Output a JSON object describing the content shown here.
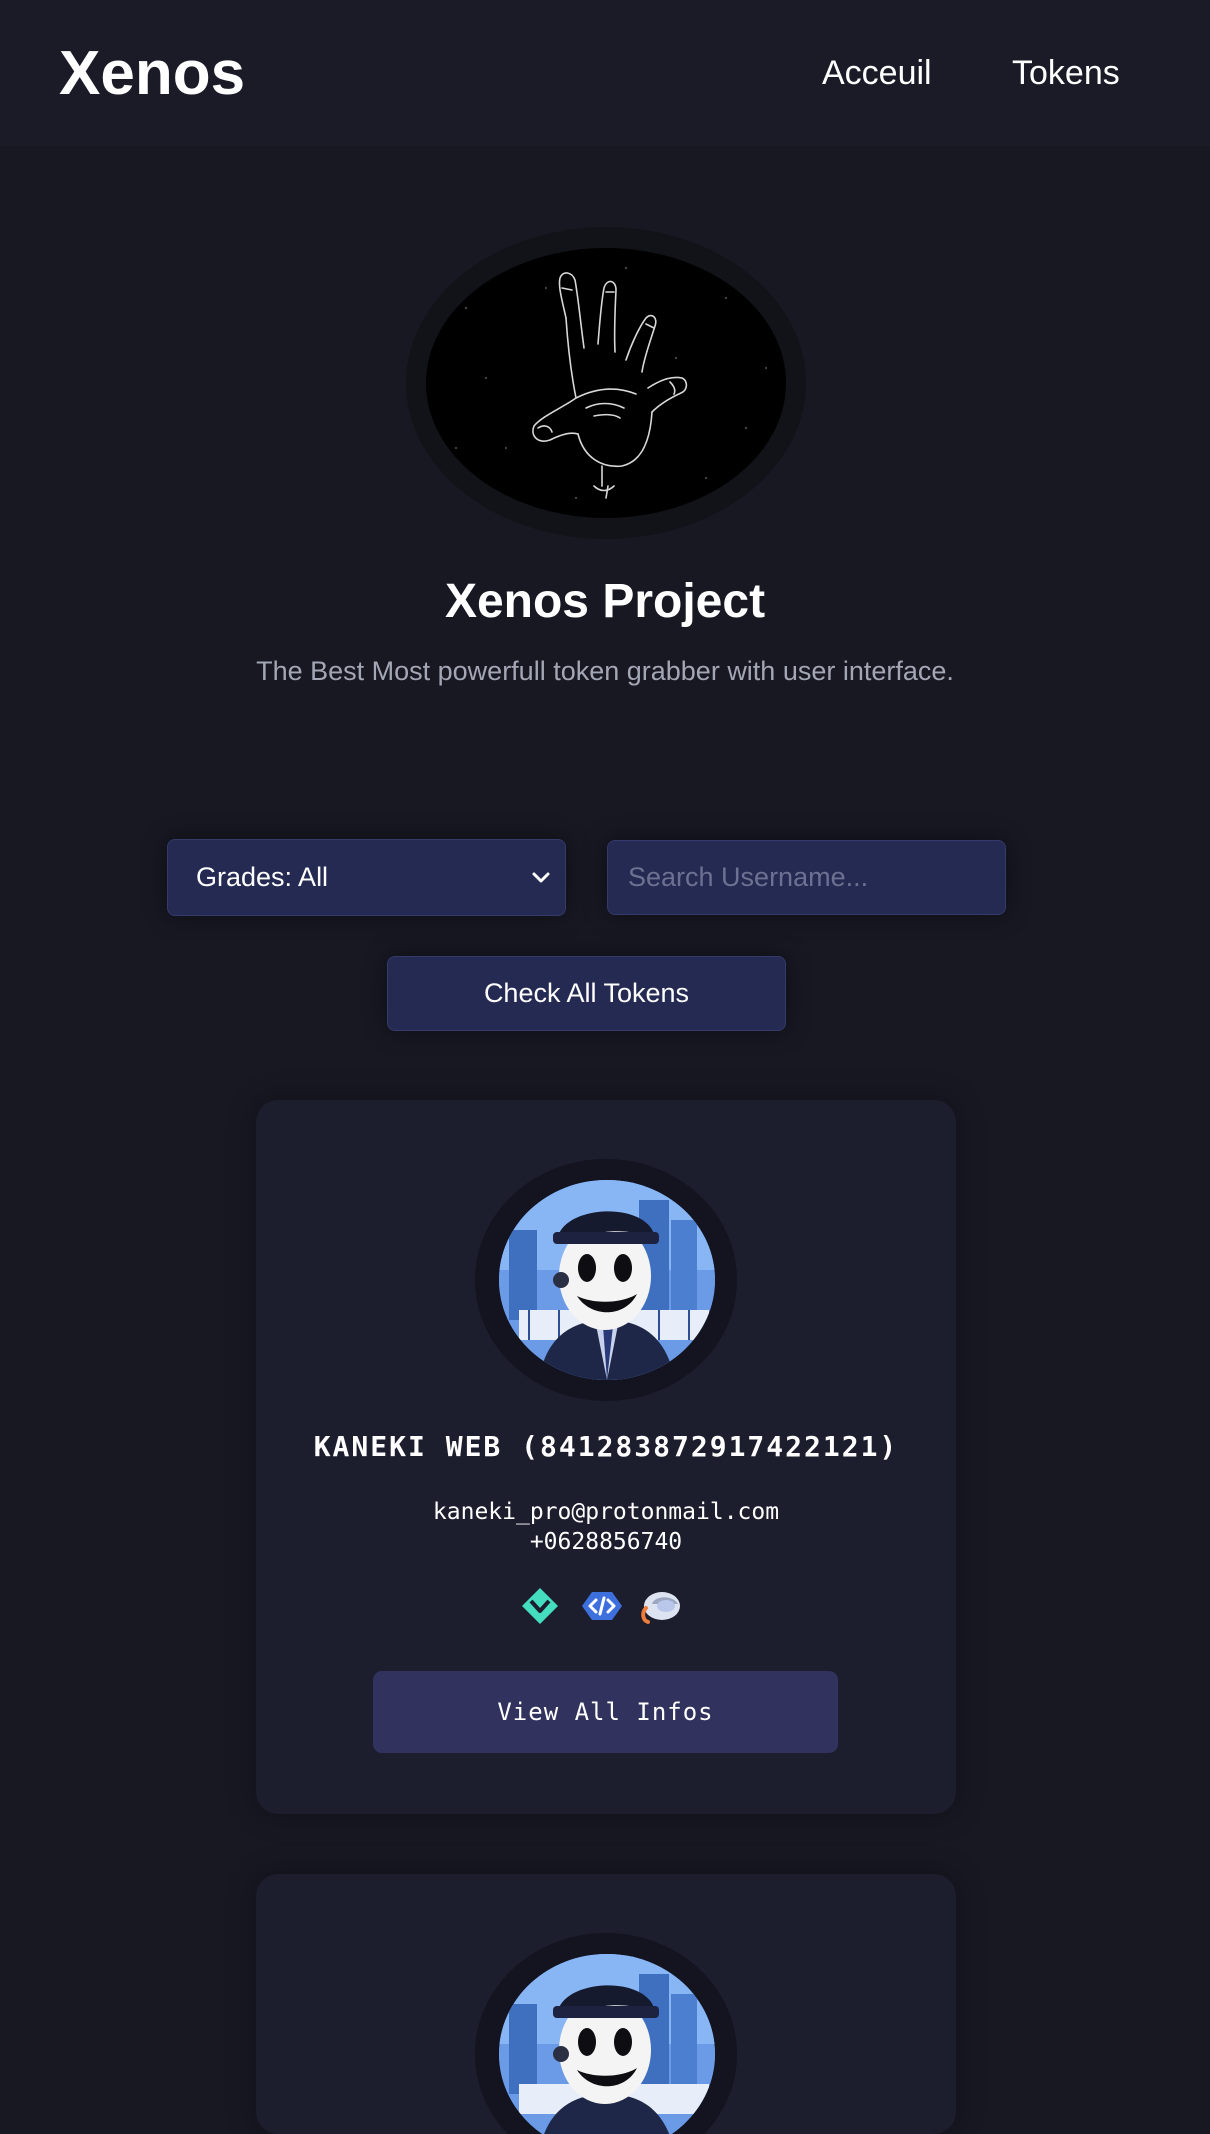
{
  "navbar": {
    "brand": "Xenos",
    "links": [
      "Acceuil",
      "Tokens"
    ]
  },
  "hero": {
    "logo_icon": "hand-sketch-icon",
    "title": "Xenos Project",
    "subtitle": "The Best Most powerfull token grabber with user interface."
  },
  "filters": {
    "grade_select": {
      "value": "Grades: All",
      "options": [
        "Grades: All"
      ]
    },
    "search": {
      "value": "",
      "placeholder": "Search Username..."
    },
    "check_button": "Check All Tokens"
  },
  "users": [
    {
      "avatar_icon": "anime-masked-man-avatar",
      "name": "KANEKI WEB (841283872917422121)",
      "email": "kaneki_pro@protonmail.com",
      "phone": "+0628856740",
      "badges": [
        "hypesquad-balance-icon",
        "active-developer-icon",
        "nitro-helmet-icon"
      ],
      "button": "View All Infos"
    },
    {
      "avatar_icon": "anime-masked-man-avatar"
    }
  ],
  "colors": {
    "background": "#171822",
    "navbar": "#1a1b27",
    "card": "#1c1d2d",
    "control": "#252a52",
    "card_button": "#31335e",
    "muted_text": "#a3a6b4"
  }
}
